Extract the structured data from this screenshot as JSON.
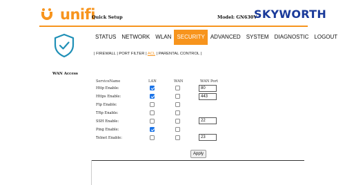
{
  "header": {
    "logo_text": "unifi",
    "quick_setup": "Quick Setup",
    "model": "Model: GN630V",
    "brand": "SKYWORTH",
    "accent": "#f7941d",
    "brand_color": "#1a3a9a"
  },
  "nav": {
    "items": [
      "STATUS",
      "NETWORK",
      "WLAN",
      "SECURITY",
      "ADVANCED",
      "SYSTEM",
      "DIAGNOSTIC",
      "LOGOUT"
    ],
    "active": "SECURITY"
  },
  "subnav": {
    "firewall": "| FIREWALL",
    "port_filter": "| PORT FILTER |",
    "acl": "ACL",
    "parental": "| PARENTAL CONTROL |"
  },
  "sidebar": {
    "label": "WAN Access"
  },
  "table": {
    "headers": {
      "service": "ServiceName",
      "lan": "LAN",
      "wan": "WAN",
      "wan_port": "WAN Port"
    },
    "rows": [
      {
        "label": "Http Enable:",
        "lan": true,
        "wan": false,
        "port": "80"
      },
      {
        "label": "Https Enable:",
        "lan": true,
        "wan": false,
        "port": "443"
      },
      {
        "label": "Ftp Enable:",
        "lan": false,
        "wan": false
      },
      {
        "label": "Tftp Enable:",
        "lan": false,
        "wan": false
      },
      {
        "label": "SSH Enable:",
        "lan": false,
        "wan": false,
        "port": "22"
      },
      {
        "label": "Ping Enable:",
        "lan": true,
        "wan": false
      },
      {
        "label": "Telnet Enable:",
        "lan": false,
        "wan": false,
        "port": "23"
      }
    ]
  },
  "apply_label": "Apply"
}
